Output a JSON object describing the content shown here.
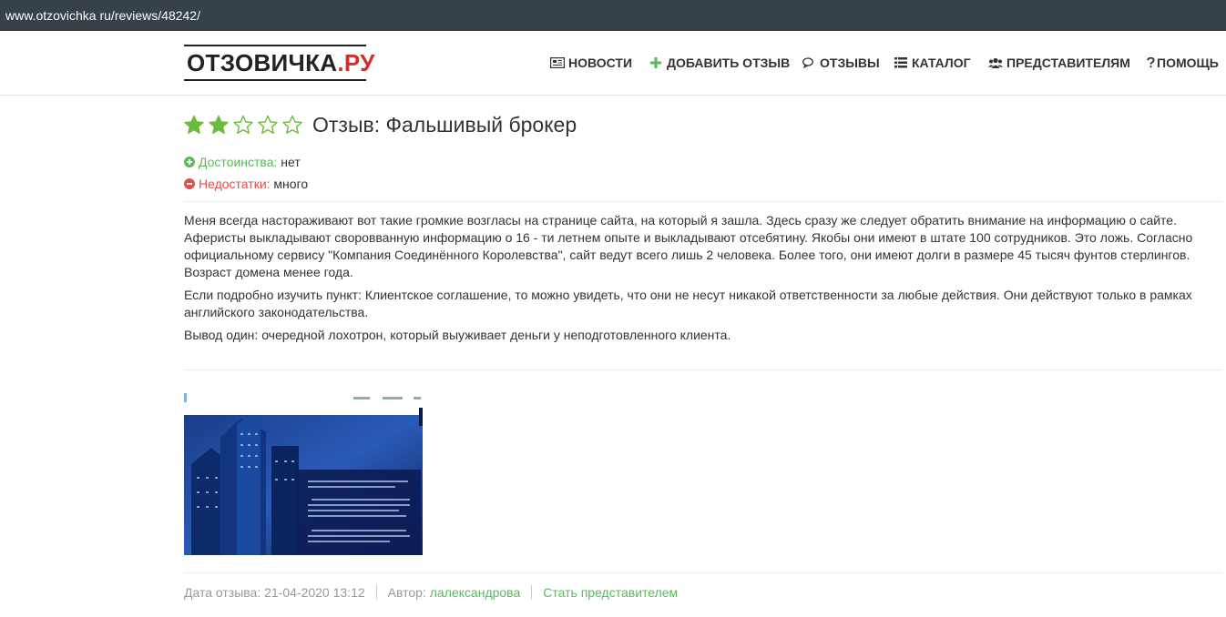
{
  "browser": {
    "url": "www.otzovichka ru/reviews/48242/"
  },
  "header": {
    "logo": {
      "part1": "ОТЗОВИЧКА",
      "part2": ".РУ"
    },
    "nav": [
      {
        "icon": "newspaper-icon",
        "label": "НОВОСТИ"
      },
      {
        "icon": "plus-icon",
        "label": "ДОБАВИТЬ ОТЗЫВ"
      },
      {
        "icon": "comments-icon",
        "label": "ОТЗЫВЫ"
      },
      {
        "icon": "list-icon",
        "label": "КАТАЛОГ"
      },
      {
        "icon": "users-icon",
        "label": "ПРЕДСТАВИТЕЛЯМ"
      },
      {
        "icon": "question-icon",
        "label": "ПОМОЩЬ"
      }
    ]
  },
  "review": {
    "rating": 2,
    "rating_max": 5,
    "title": "Отзыв: Фальшивый брокер",
    "pros_label": "Достоинства:",
    "pros_value": "нет",
    "cons_label": "Недостатки:",
    "cons_value": "много",
    "paragraphs": [
      "Меня всегда настораживают вот такие громкие возгласы на странице сайта, на который я зашла. Здесь сразу же следует обратить внимание на информацию о сайте. Аферисты выкладывают своровванную информацию о 16 - ти летнем опыте и выкладывают отсебятину. Якобы они имеют в штате 100 сотрудников. Это ложь. Согласно официальному сервису \"Компания Соединённого Королевства\", сайт ведут всего лишь 2 человека. Более того, они имеют долги в размере 45 тысяч фунтов стерлингов. Возраст домена менее года.",
      "Если подробно изучить пункт: Клиентское соглашение, то можно увидеть, что они не несут никакой ответственности за любые действия. Они действуют только в рамках английского законодательства.",
      "Вывод один: очередной лохотрон, который выуживает деньги у неподготовленного клиента."
    ],
    "footer": {
      "date_label": "Дата отзыва:",
      "date_value": "21-04-2020 13:12",
      "author_label": "Автор:",
      "author_value": "лалександрова",
      "become_rep": "Стать представителем"
    }
  },
  "colors": {
    "accent_green": "#5cb85c",
    "accent_red": "#d9534f",
    "star": "#6cbb3c",
    "urlbar": "#364148"
  }
}
